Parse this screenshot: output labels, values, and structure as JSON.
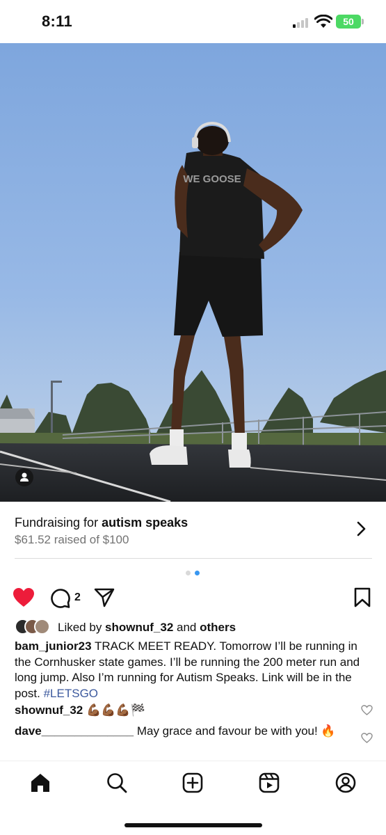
{
  "status_bar": {
    "time": "8:11",
    "battery": "50"
  },
  "post": {
    "photo": {
      "icon": "person-tag-icon",
      "shirt_text": "WE GOOSE"
    },
    "fundraiser": {
      "prefix": "Fundraising for ",
      "cause": "autism speaks",
      "progress": "$61.52 raised of $100"
    },
    "carousel": {
      "current": 2,
      "total": 2
    },
    "actions": {
      "comment_count": "2",
      "like_color": "#ed1c3a"
    },
    "likes": {
      "prefix": "Liked by ",
      "user": "shownuf_32",
      "middle": " and ",
      "others": "others"
    },
    "caption": {
      "user": "bam_junior23",
      "text": " TRACK MEET READY. Tomorrow I’ll be running in the Cornhusker state games. I’ll be running the 200 meter run and long jump. Also I’m running for Autism Speaks. Link will be in the post. ",
      "hashtag": "#LETSGO"
    },
    "comments": [
      {
        "user": "shownuf_32",
        "text": " 💪🏾💪🏾💪🏾🏁"
      },
      {
        "user": "dave______________",
        "text": " May grace and favour be with you! 🔥"
      }
    ]
  },
  "bottom_nav": {
    "items": [
      "home",
      "search",
      "create",
      "reels",
      "profile"
    ]
  },
  "colors": {
    "sky_top": "#7ea6dd",
    "sky_bottom": "#b9cde6",
    "accent_link": "#3d5a9e",
    "carousel_active": "#3897f0"
  }
}
